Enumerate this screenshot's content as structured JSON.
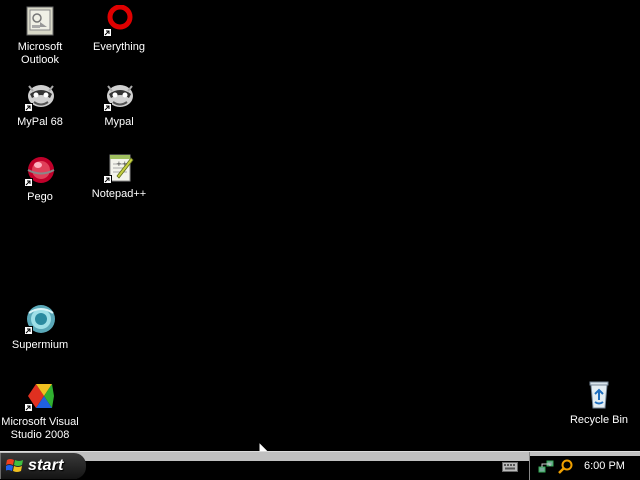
{
  "desktop": {
    "background": "#000000",
    "icons": [
      {
        "label": "Microsoft\nOutlook",
        "icon": "outlook-icon"
      },
      {
        "label": "Everything",
        "icon": "everything-icon"
      },
      {
        "label": "MyPal 68",
        "icon": "mypal-icon"
      },
      {
        "label": "Mypal",
        "icon": "mypal-icon"
      },
      {
        "label": "Pego",
        "icon": "pego-icon"
      },
      {
        "label": "Notepad++",
        "icon": "notepadpp-icon"
      },
      {
        "label": "Supermium",
        "icon": "supermium-icon"
      },
      {
        "label": "Microsoft Visual\nStudio 2008",
        "icon": "visual-studio-icon"
      },
      {
        "label": "Recycle Bin",
        "icon": "recycle-bin-icon"
      }
    ]
  },
  "taskbar": {
    "start_label": "start",
    "clock": "6:00 PM",
    "tray_icons": [
      "network-icon",
      "search-icon"
    ],
    "colors": {
      "bar": "#c0c0c0",
      "start": "#222222"
    }
  }
}
